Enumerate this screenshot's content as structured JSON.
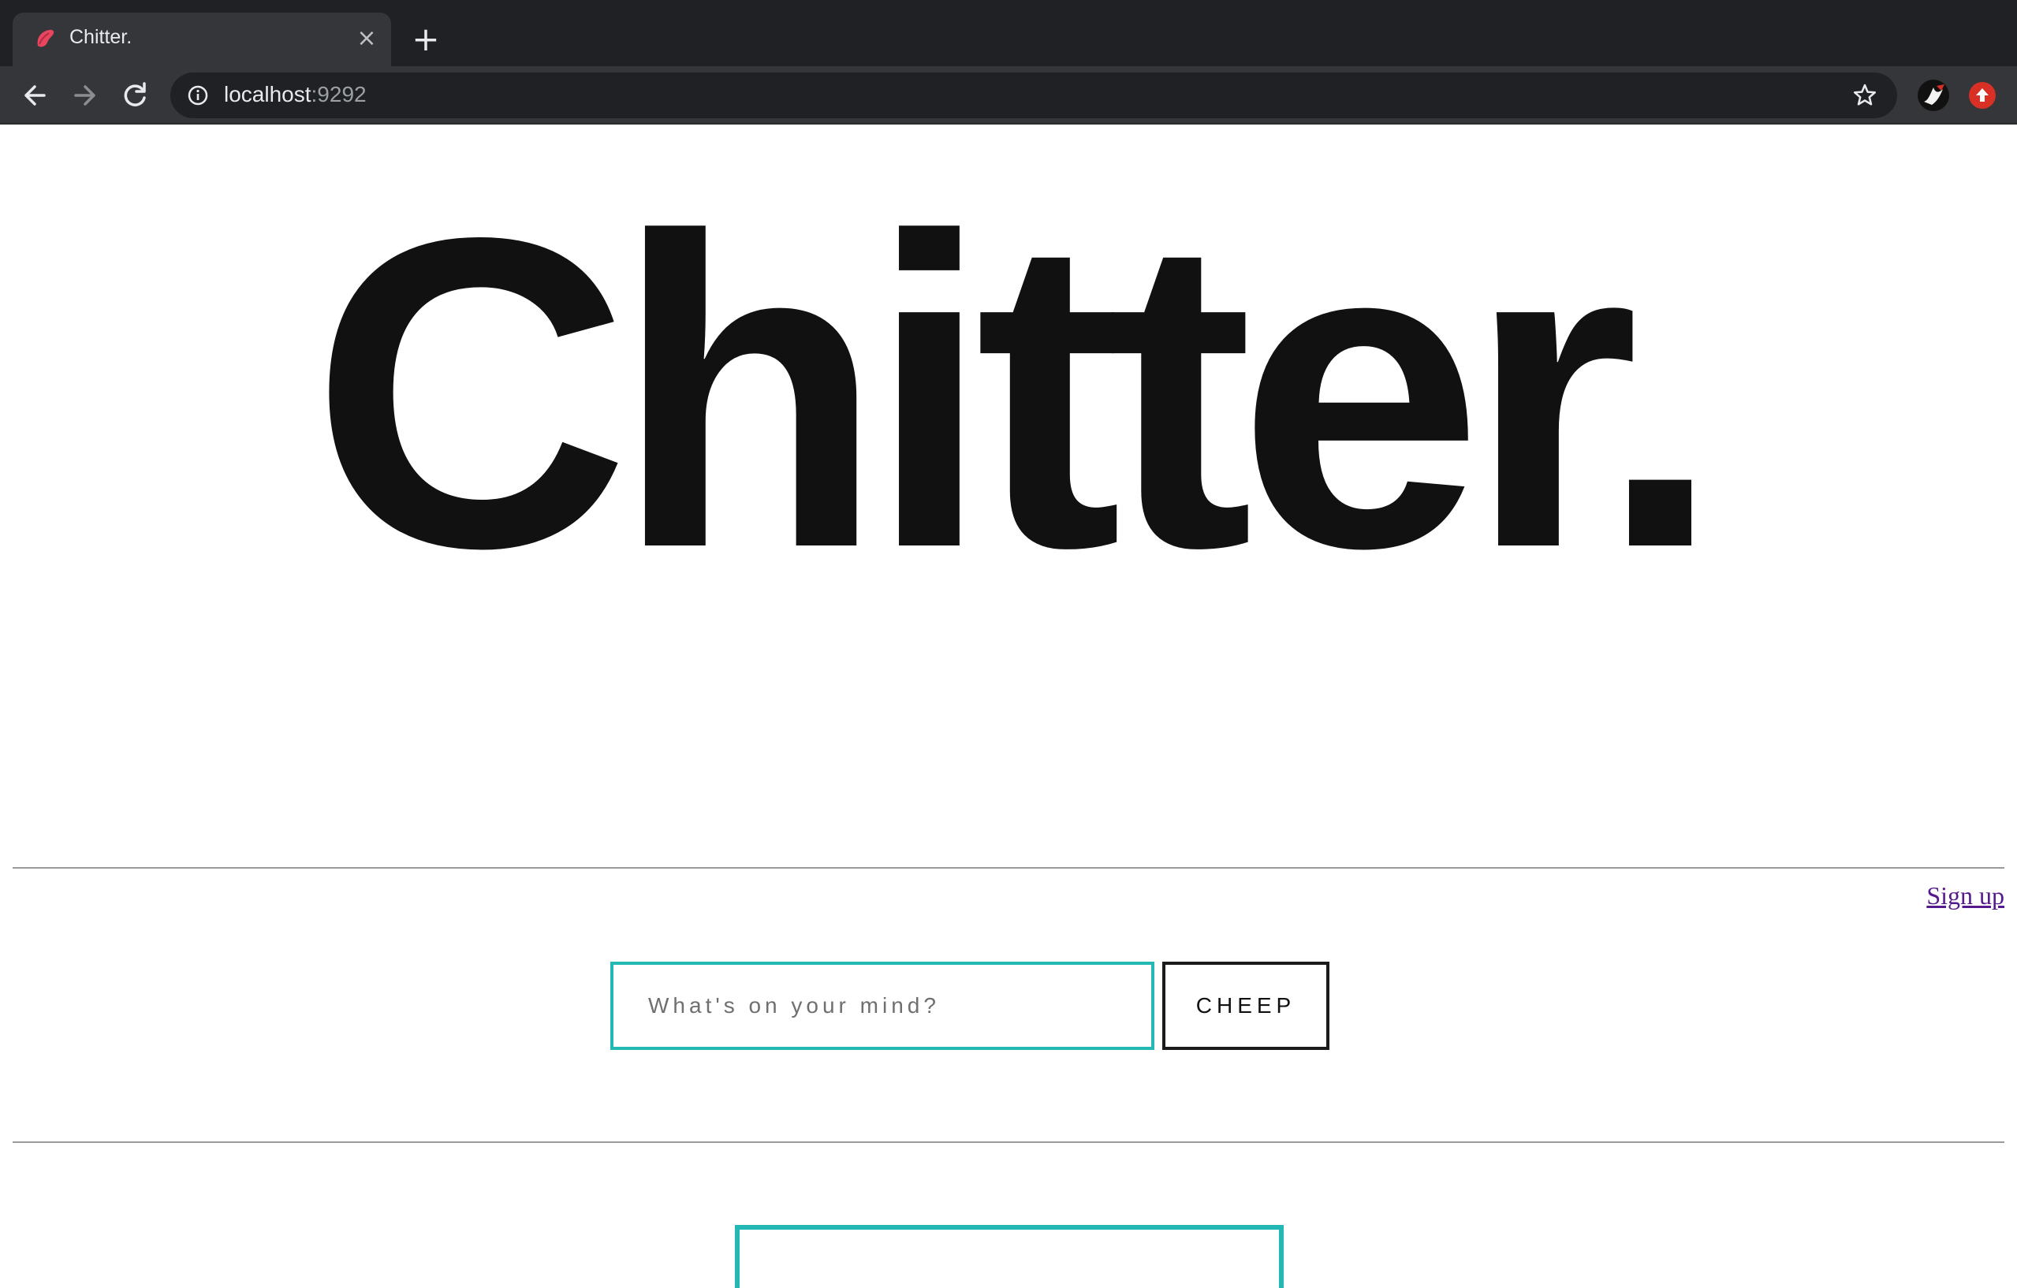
{
  "browser": {
    "tab": {
      "title": "Chitter.",
      "favicon": "bird-favicon-icon"
    },
    "url": {
      "host": "localhost",
      "port": ":9292"
    },
    "icons": {
      "back": "back-arrow-icon",
      "forward": "forward-arrow-icon",
      "reload": "reload-icon",
      "site_info": "info-icon",
      "bookmark": "star-icon",
      "new_tab": "plus-icon",
      "close_tab": "close-icon"
    },
    "colors": {
      "frame": "#202124",
      "toolbar": "#35363a",
      "text": "#e8eaed"
    }
  },
  "page": {
    "logo": "Chitter.",
    "signup_link": "Sign up",
    "cheep_form": {
      "placeholder": "What's on your mind?",
      "value": "",
      "button_label": "CHEEP"
    },
    "colors": {
      "accent": "#23b8b4",
      "text": "#111111",
      "link": "#551a8b"
    }
  }
}
